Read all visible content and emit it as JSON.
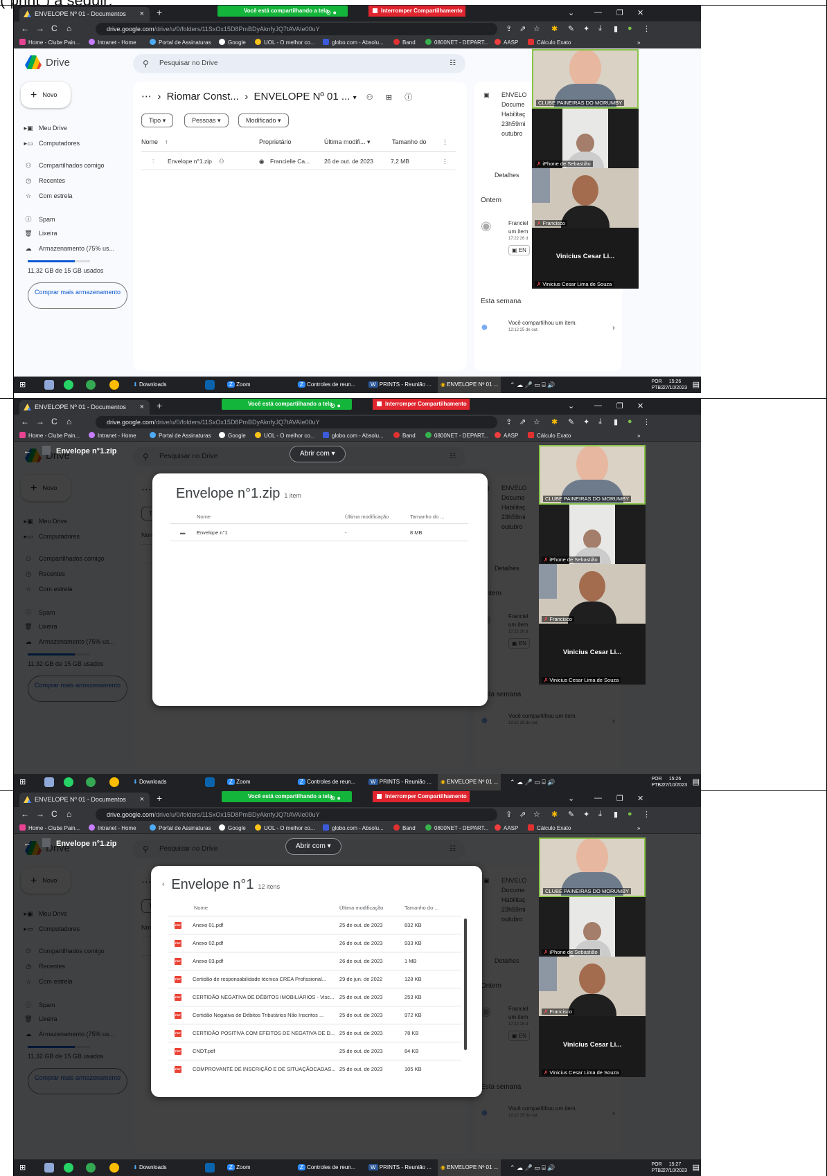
{
  "caption": "(“print”) a seguir:",
  "browser": {
    "tab_title": "ENVELOPE Nº 01 - Documentos",
    "share_text": "Você está compartilhando a tela",
    "stop_share": "Interromper Compartilhamento",
    "url_host": "drive.google.com",
    "url_path": "/drive/u/0/folders/11SxOx15D8PmBDyAknfyJQ7tAVAIe00uY",
    "bookmarks": [
      "Home - Clube Pain...",
      "Intranet - Home",
      "Portal de Assinaturas",
      "Google",
      "UOL - O melhor co...",
      "globo.com - Absolu...",
      "Band",
      "0800NET - DEPART...",
      "AASP",
      "Cálculo Exato"
    ]
  },
  "taskbar": {
    "items": [
      "Downloads",
      "Zoom",
      "Controles de reun...",
      "PRINTS - Reunião ...",
      "ENVELOPE Nº 01 ..."
    ],
    "lang1": "POR",
    "lang2": "PTB2",
    "frames": [
      {
        "time": "15:26",
        "date": "27/10/2023"
      },
      {
        "time": "15:26",
        "date": "27/10/2023"
      },
      {
        "time": "15:27",
        "date": "27/10/2023"
      }
    ]
  },
  "drive": {
    "logo": "Drive",
    "new": "Novo",
    "search_placeholder": "Pesquisar no Drive",
    "nav": [
      "Meu Drive",
      "Computadores",
      "Compartilhados comigo",
      "Recentes",
      "Com estrela",
      "Spam",
      "Lixeira",
      "Armazenamento (75% us..."
    ],
    "storage_used": "11,32 GB de 15 GB usados",
    "storage_fraction": 0.75,
    "buy_more": "Comprar mais armazenamento",
    "breadcrumb": {
      "ellipsis": "⋯",
      "parent": "Riomar Const...",
      "current": "ENVELOPE Nº 01 ..."
    },
    "chips": [
      "Tipo",
      "Pessoas",
      "Modificado"
    ],
    "headers": {
      "name": "Nome",
      "owner": "Proprietário",
      "modified": "Última modifi...",
      "size": "Tamanho do"
    },
    "file": {
      "name": "Envelope n°1.zip",
      "owner": "Francielle Ca...",
      "modified": "26 de out. de 2023",
      "size": "7,2 MB"
    },
    "details": {
      "title": "ENVELO",
      "lines": [
        "Docume",
        "Habilitaç",
        "23h59mi",
        "outubro"
      ],
      "tab": "Detalhes",
      "yesterday": "Ontem",
      "activity": [
        "Franciel",
        "um item",
        "17:22 26 d",
        "EN"
      ],
      "week": "Esta semana",
      "shared": "Você compartilhou um item.",
      "shared_time": "12:12 25 de out."
    }
  },
  "video": {
    "participants": [
      "CLUBE PAINEIRAS DO MORUMBY",
      "iPhone de Sebastião",
      "Francisco",
      "Vinicius Cesar Lima de Souza"
    ],
    "big_name": "Vinicius Cesar Li..."
  },
  "viewer": {
    "title": "Envelope n°1.zip",
    "open_with": "Abrir com",
    "zip_count": "1 item",
    "headers": {
      "name": "Nome",
      "modified": "Última modificação",
      "size": "Tamanho do ..."
    },
    "zip_row": {
      "name": "Envelope n°1",
      "modified": "-",
      "size": "8 MB"
    },
    "folder_title": "Envelope n°1",
    "folder_count": "12 itens",
    "files": [
      {
        "name": "Anexo 01.pdf",
        "modified": "25 de out. de 2023",
        "size": "832 KB"
      },
      {
        "name": "Anexo 02.pdf",
        "modified": "26 de out. de 2023",
        "size": "933 KB"
      },
      {
        "name": "Anexo 03.pdf",
        "modified": "26 de out. de 2023",
        "size": "1 MB"
      },
      {
        "name": "Certidão de responsabilidade técnica CREA Profissional...",
        "modified": "29 de jun. de 2022",
        "size": "128 KB"
      },
      {
        "name": "CERTIDÃO NEGATIVA DE DÉBITOS IMOBILIÁRIOS - Visc...",
        "modified": "25 de out. de 2023",
        "size": "253 KB"
      },
      {
        "name": "Certidão Negativa de Débitos Tributários Não Inscritos ...",
        "modified": "25 de out. de 2023",
        "size": "972 KB"
      },
      {
        "name": "CERTIDÃO POSITIVA COM EFEITOS DE NEGATIVA DE D...",
        "modified": "25 de out. de 2023",
        "size": "78 KB"
      },
      {
        "name": "CNDT.pdf",
        "modified": "25 de out. de 2023",
        "size": "84 KB"
      },
      {
        "name": "COMPROVANTE DE INSCRIÇÃO E DE SITUAÇÃOCADAS...",
        "modified": "25 de out. de 2023",
        "size": "105 KB"
      }
    ]
  }
}
